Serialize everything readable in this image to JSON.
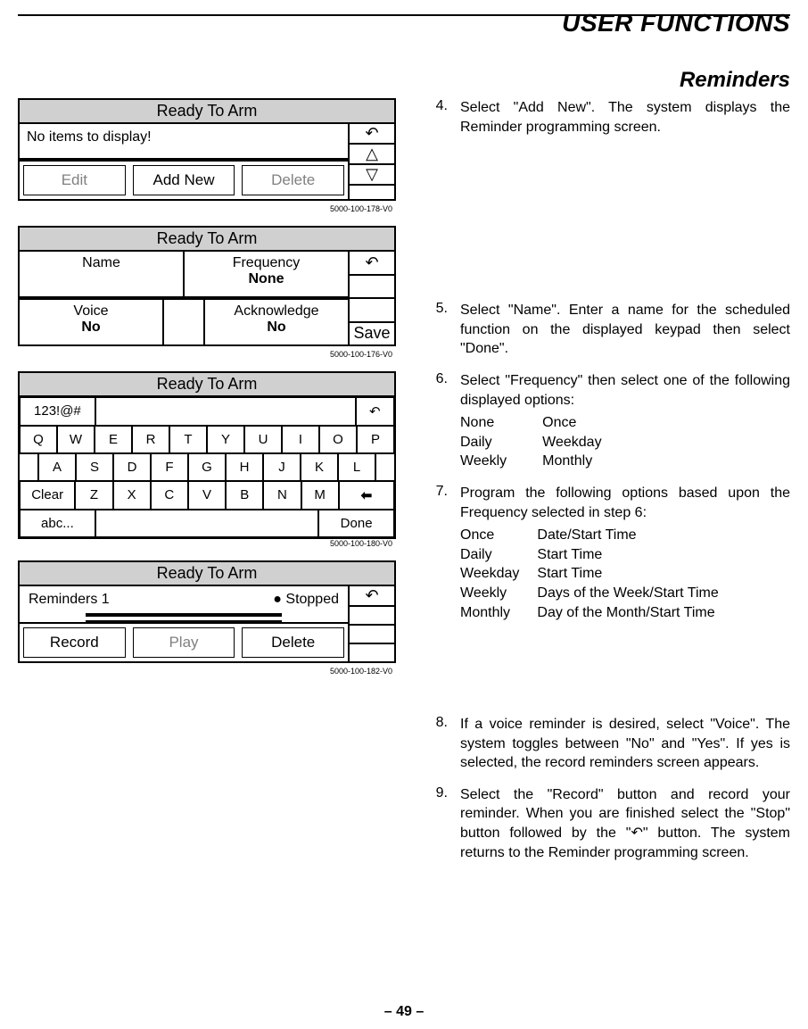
{
  "header": {
    "title": "USER FUNCTIONS",
    "subtitle": "Reminders"
  },
  "page_number": "– 49 –",
  "screens": {
    "s1": {
      "title": "Ready To Arm",
      "msg": "No items to display!",
      "btn_edit": "Edit",
      "btn_add": "Add New",
      "btn_delete": "Delete",
      "caption": "5000-100-178-V0"
    },
    "s2": {
      "title": "Ready To Arm",
      "name_lbl": "Name",
      "freq_lbl": "Frequency",
      "freq_val": "None",
      "voice_lbl": "Voice",
      "voice_val": "No",
      "ack_lbl": "Acknowledge",
      "ack_val": "No",
      "save": "Save",
      "caption": "5000-100-176-V0"
    },
    "s3": {
      "title": "Ready To Arm",
      "sym": "123!@#",
      "row1": [
        "Q",
        "W",
        "E",
        "R",
        "T",
        "Y",
        "U",
        "I",
        "O",
        "P"
      ],
      "row2": [
        "A",
        "S",
        "D",
        "F",
        "G",
        "H",
        "J",
        "K",
        "L"
      ],
      "clear": "Clear",
      "row3": [
        "Z",
        "X",
        "C",
        "V",
        "B",
        "N",
        "M"
      ],
      "abc": "abc...",
      "done": "Done",
      "caption": "5000-100-180-V0"
    },
    "s4": {
      "title": "Ready To Arm",
      "label": "Reminders 1",
      "status": "Stopped",
      "record": "Record",
      "play": "Play",
      "delete": "Delete",
      "caption": "5000-100-182-V0"
    }
  },
  "steps": {
    "n4": "4.",
    "t4": "Select \"Add New\". The system displays the Reminder programming screen.",
    "n5": "5.",
    "t5": "Select \"Name\". Enter a name for the scheduled function on the displayed keypad then select \"Done\".",
    "n6": "6.",
    "t6": "Select \"Frequency\" then select one of the following displayed options:",
    "freq_opts": {
      "c1": [
        "None",
        "Daily",
        " Weekly"
      ],
      "c2": [
        "Once",
        "Weekday",
        " Monthly"
      ]
    },
    "n7": "7.",
    "t7": "Program the following options based upon the Frequency selected in step 6:",
    "opt_tab": [
      [
        "Once",
        "Date/Start Time"
      ],
      [
        "Daily",
        "Start Time"
      ],
      [
        "Weekday",
        "Start Time"
      ],
      [
        "Weekly",
        "Days of the Week/Start Time"
      ],
      [
        "Monthly",
        "Day of the Month/Start Time"
      ]
    ],
    "n8": "8.",
    "t8": "If a voice reminder is desired, select \"Voice\". The system toggles between \"No\" and \"Yes\". If yes is selected, the record reminders screen appears.",
    "n9": "9.",
    "t9": "Select the \"Record\" button and record your reminder. When you are finished select the \"Stop\" button followed by the \"↶\" button. The system returns to the Reminder programming screen."
  }
}
